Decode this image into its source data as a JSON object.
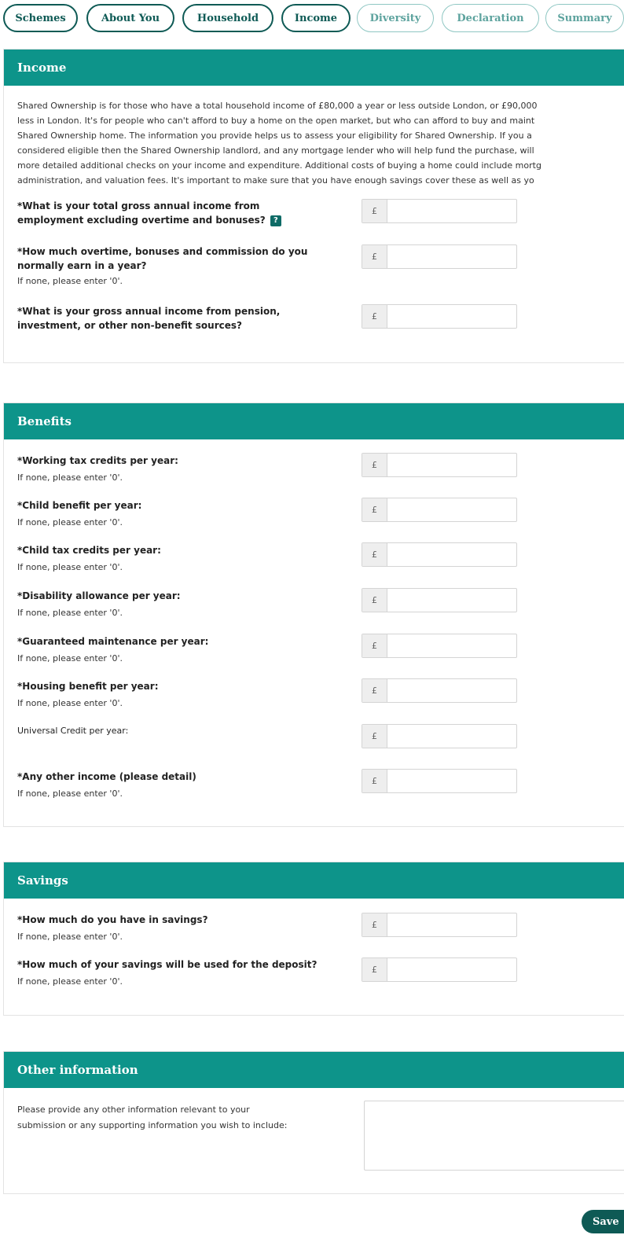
{
  "tabs": [
    {
      "label": "Schemes",
      "state": "active"
    },
    {
      "label": "About You",
      "state": "active"
    },
    {
      "label": "Household",
      "state": "active"
    },
    {
      "label": "Income",
      "state": "current"
    },
    {
      "label": "Diversity",
      "state": "inactive"
    },
    {
      "label": "Declaration",
      "state": "inactive"
    },
    {
      "label": "Summary",
      "state": "inactive"
    }
  ],
  "currency_symbol": "£",
  "income": {
    "title": "Income",
    "intro_lines": [
      "Shared Ownership is for those who have a total household income of £80,000 a year or less outside London, or £90,000",
      "less in London. It's for people who can't afford to buy a home on the open market, but who can afford to buy and maint",
      "Shared Ownership home. The information you provide helps us to assess your eligibility for Shared Ownership. If you a",
      "considered eligible then the Shared Ownership landlord, and any mortgage lender who will help fund the purchase, will",
      "more detailed additional checks on your income and expenditure. Additional costs of buying a home could include mortg",
      "administration, and valuation fees. It's important to make sure that you have enough savings cover these as well as yo"
    ],
    "q1": {
      "line1": "*What is your total gross annual income from",
      "line2": "employment excluding overtime and bonuses?",
      "value": ""
    },
    "q2": {
      "line1": "*How much overtime, bonuses and commission do you",
      "line2": "normally earn in a year?",
      "hint": "If none, please enter '0'.",
      "value": ""
    },
    "q3": {
      "line1": "*What is your gross annual income from pension,",
      "line2": "investment, or other non-benefit sources?",
      "value": ""
    }
  },
  "benefits": {
    "title": "Benefits",
    "items": [
      {
        "label": "*Working tax credits per year:",
        "hint": "If none, please enter '0'.",
        "value": ""
      },
      {
        "label": "*Child benefit per year:",
        "hint": "If none, please enter '0'.",
        "value": ""
      },
      {
        "label": "*Child tax credits per year:",
        "hint": "If none, please enter '0'.",
        "value": ""
      },
      {
        "label": "*Disability allowance per year:",
        "hint": "If none, please enter '0'.",
        "value": ""
      },
      {
        "label": "*Guaranteed maintenance per year:",
        "hint": "If none, please enter '0'.",
        "value": ""
      },
      {
        "label": "*Housing benefit per year:",
        "hint": "If none, please enter '0'.",
        "value": ""
      },
      {
        "label": "Universal Credit per year:",
        "hint": "",
        "value": ""
      },
      {
        "label": "*Any other income (please detail)",
        "hint": "If none, please enter '0'.",
        "value": ""
      }
    ]
  },
  "savings": {
    "title": "Savings",
    "items": [
      {
        "label": "*How much do you have in savings?",
        "hint": "If none, please enter '0'.",
        "value": ""
      },
      {
        "label": "*How much of your savings will be used for the deposit?",
        "hint": "If none, please enter '0'.",
        "value": ""
      }
    ]
  },
  "other": {
    "title": "Other information",
    "prompt_line1": "Please provide any other information relevant to your",
    "prompt_line2": "submission or any supporting information you wish to include:",
    "value": ""
  },
  "save_label": "Save"
}
